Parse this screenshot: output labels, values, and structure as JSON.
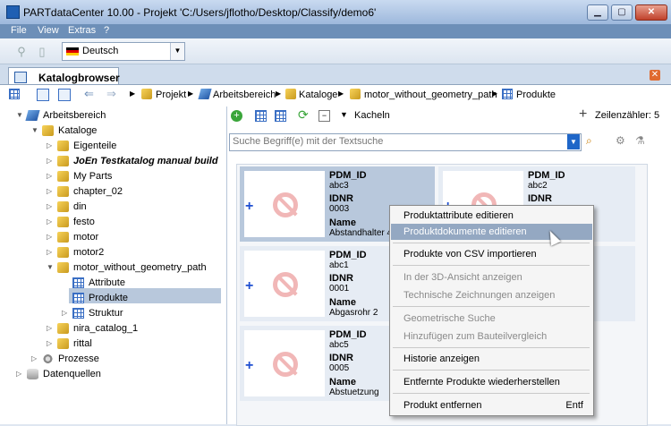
{
  "window": {
    "title": "PARTdataCenter 10.00 - Projekt 'C:/Users/jflotho/Desktop/Classify/demo6'",
    "minimize": "▁",
    "maximize": "▢",
    "close": "✕"
  },
  "menu": [
    "File",
    "View",
    "Extras",
    "?"
  ],
  "toolbar": {
    "language": "Deutsch"
  },
  "tab": {
    "label": "Katalogbrowser"
  },
  "breadcrumb": [
    "Projekt",
    "Arbeitsbereich",
    "Kataloge",
    "motor_without_geometry_path",
    "Produkte"
  ],
  "tree": [
    {
      "label": "Arbeitsbereich",
      "indent": 0,
      "expander": "▼",
      "icon": "book-icon"
    },
    {
      "label": "Kataloge",
      "indent": 1,
      "expander": "▼",
      "icon": "catalog-icon"
    },
    {
      "label": "Eigenteile",
      "indent": 2,
      "expander": "▷",
      "icon": "folder-icon"
    },
    {
      "label": "JoEn Testkatalog manual build",
      "indent": 2,
      "expander": "▷",
      "icon": "folder-icon",
      "bold": true
    },
    {
      "label": "My Parts",
      "indent": 2,
      "expander": "▷",
      "icon": "folder-icon"
    },
    {
      "label": "chapter_02",
      "indent": 2,
      "expander": "▷",
      "icon": "folder-icon"
    },
    {
      "label": "din",
      "indent": 2,
      "expander": "▷",
      "icon": "folder-icon"
    },
    {
      "label": "festo",
      "indent": 2,
      "expander": "▷",
      "icon": "folder-icon"
    },
    {
      "label": "motor",
      "indent": 2,
      "expander": "▷",
      "icon": "folder-icon"
    },
    {
      "label": "motor2",
      "indent": 2,
      "expander": "▷",
      "icon": "folder-icon"
    },
    {
      "label": "motor_without_geometry_path",
      "indent": 2,
      "expander": "▼",
      "icon": "folder-icon"
    },
    {
      "label": "Attribute",
      "indent": 3,
      "expander": "",
      "icon": "grid-icon"
    },
    {
      "label": "Produkte",
      "indent": 3,
      "expander": "",
      "icon": "grid-icon",
      "selected": true
    },
    {
      "label": "Struktur",
      "indent": 3,
      "expander": "▷",
      "icon": "grid-icon"
    },
    {
      "label": "nira_catalog_1",
      "indent": 2,
      "expander": "▷",
      "icon": "folder-icon"
    },
    {
      "label": "rittal",
      "indent": 2,
      "expander": "▷",
      "icon": "folder-icon"
    },
    {
      "label": "Prozesse",
      "indent": 1,
      "expander": "▷",
      "icon": "gear-icon"
    },
    {
      "label": "Datenquellen",
      "indent": 0,
      "expander": "▷",
      "icon": "database-icon"
    }
  ],
  "view": {
    "mode_label": "Kacheln",
    "row_counter": "Zeilenzähler: 5"
  },
  "search": {
    "placeholder": "Suche Begriff(e) mit der Textsuche"
  },
  "cards": [
    {
      "pdm_label": "PDM_ID",
      "pdm": "abc3",
      "idnr_label": "IDNR",
      "idnr": "0003",
      "name_label": "Name",
      "name": "Abstandhalter 4",
      "selected": true
    },
    {
      "pdm_label": "PDM_ID",
      "pdm": "abc2",
      "idnr_label": "IDNR",
      "idnr": "",
      "name_label": "",
      "name": ""
    },
    {
      "pdm_label": "PDM_ID",
      "pdm": "abc1",
      "idnr_label": "IDNR",
      "idnr": "0001",
      "name_label": "Name",
      "name": "Abgasrohr 2"
    },
    {
      "pdm_label": "PDM_ID",
      "pdm": "abc5",
      "idnr_label": "IDNR",
      "idnr": "0005",
      "name_label": "Name",
      "name": "Abstuetzung"
    }
  ],
  "context_menu": [
    {
      "label": "Produktattribute editieren",
      "enabled": true
    },
    {
      "label": "Produktdokumente editieren",
      "enabled": true,
      "hover": true
    },
    {
      "label": "Produkte von CSV importieren",
      "enabled": true
    },
    {
      "label": "In der 3D-Ansicht anzeigen",
      "enabled": false
    },
    {
      "label": "Technische Zeichnungen anzeigen",
      "enabled": false
    },
    {
      "label": "Geometrische Suche",
      "enabled": false
    },
    {
      "label": "Hinzufügen zum Bauteilvergleich",
      "enabled": false
    },
    {
      "label": "Historie anzeigen",
      "enabled": true
    },
    {
      "label": "Entfernte Produkte wiederherstellen",
      "enabled": true
    },
    {
      "label": "Produkt entfernen",
      "enabled": true,
      "shortcut": "Entf"
    }
  ]
}
